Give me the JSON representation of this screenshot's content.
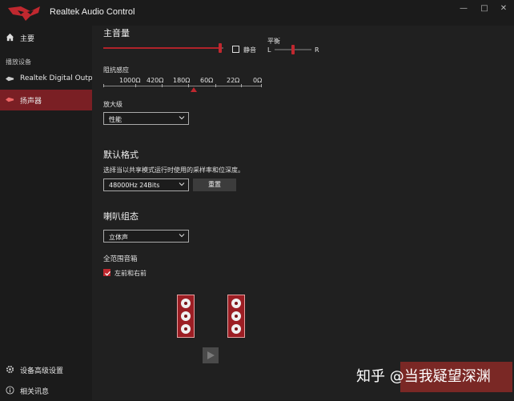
{
  "window": {
    "title": "Realtek Audio Control",
    "controls": {
      "minimize": "—",
      "maximize": "□",
      "close": "✕"
    }
  },
  "sidebar": {
    "home": "主要",
    "section_label": "播放设备",
    "devices": [
      {
        "label": "Realtek Digital Output"
      },
      {
        "label": "扬声器"
      }
    ],
    "bottom": [
      {
        "label": "设备高级设置"
      },
      {
        "label": "相关讯息"
      }
    ]
  },
  "main": {
    "master_volume_title": "主音量",
    "master_volume": 0.97,
    "mute_label": "静音",
    "mute_checked": false,
    "balance_label": "平衡",
    "balance_left": "L",
    "balance_right": "R",
    "balance_value": 0.5,
    "impedance_label": "阻抗感应",
    "impedance_values": [
      "1000Ω",
      "420Ω",
      "180Ω",
      "60Ω",
      "22Ω",
      "0Ω"
    ],
    "impedance_marker": 0.5,
    "amp_label": "放大级",
    "amp_value": "性能",
    "default_format_title": "默认格式",
    "default_format_desc": "选择当以共享模式运行时使用的采样率和位深度。",
    "format_value": "48000Hz 24Bits",
    "reset_label": "重置",
    "speaker_config_title": "喇叭组态",
    "speaker_config_value": "立体声",
    "fullrange_label": "全范围音箱",
    "front_lr_label": "左前和右前",
    "front_lr_checked": true
  },
  "watermark": "知乎 @当我疑望深渊",
  "colors": {
    "accent": "#c0282f",
    "active_bg": "#7a1f24",
    "bg": "#1b1b1b",
    "panel": "#202020"
  },
  "icons": {
    "home": "home-icon",
    "device": "speaker-icon",
    "gear": "gear-icon",
    "info": "info-icon"
  }
}
